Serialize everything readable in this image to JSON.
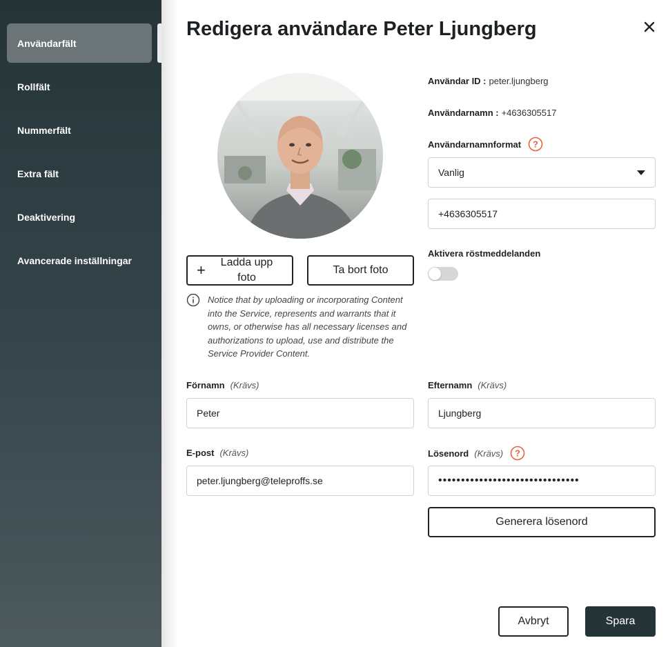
{
  "sidebar": {
    "items": [
      {
        "label": "Användarfält",
        "active": true
      },
      {
        "label": "Rollfält"
      },
      {
        "label": "Nummerfält"
      },
      {
        "label": "Extra fält"
      },
      {
        "label": "Deaktivering"
      },
      {
        "label": "Avancerade inställningar"
      }
    ]
  },
  "dialog": {
    "title": "Redigera användare Peter Ljungberg",
    "close_icon": "close-icon"
  },
  "photo": {
    "upload_label": "Ladda upp foto",
    "remove_label": "Ta bort foto",
    "notice": "Notice that by uploading or incorporating Content into the Service, represents and warrants that it owns, or otherwise has all necessary licenses and authorizations to upload, use and distribute the Service Provider Content."
  },
  "user": {
    "id_label": "Användar ID :",
    "id_value": "peter.ljungberg",
    "username_label": "Användarnamn :",
    "username_value": "+4636305517",
    "username_format_label": "Användarnamnformat",
    "username_format_value": "Vanlig",
    "username_field_value": "+4636305517",
    "voicemail_label": "Aktivera röstmeddelanden",
    "voicemail_enabled": false
  },
  "form": {
    "required": "(Krävs)",
    "firstname_label": "Förnamn",
    "firstname_value": "Peter",
    "lastname_label": "Efternamn",
    "lastname_value": "Ljungberg",
    "email_label": "E-post",
    "email_value": "peter.ljungberg@teleproffs.se",
    "password_label": "Lösenord",
    "password_value": "•••••••••••••••••••••••••••••••",
    "generate_label": "Generera lösenord"
  },
  "footer": {
    "cancel_label": "Avbryt",
    "save_label": "Spara"
  },
  "colors": {
    "sidebar_bg": "#253436",
    "accent_orange": "#e8603c",
    "primary_button": "#253436"
  }
}
